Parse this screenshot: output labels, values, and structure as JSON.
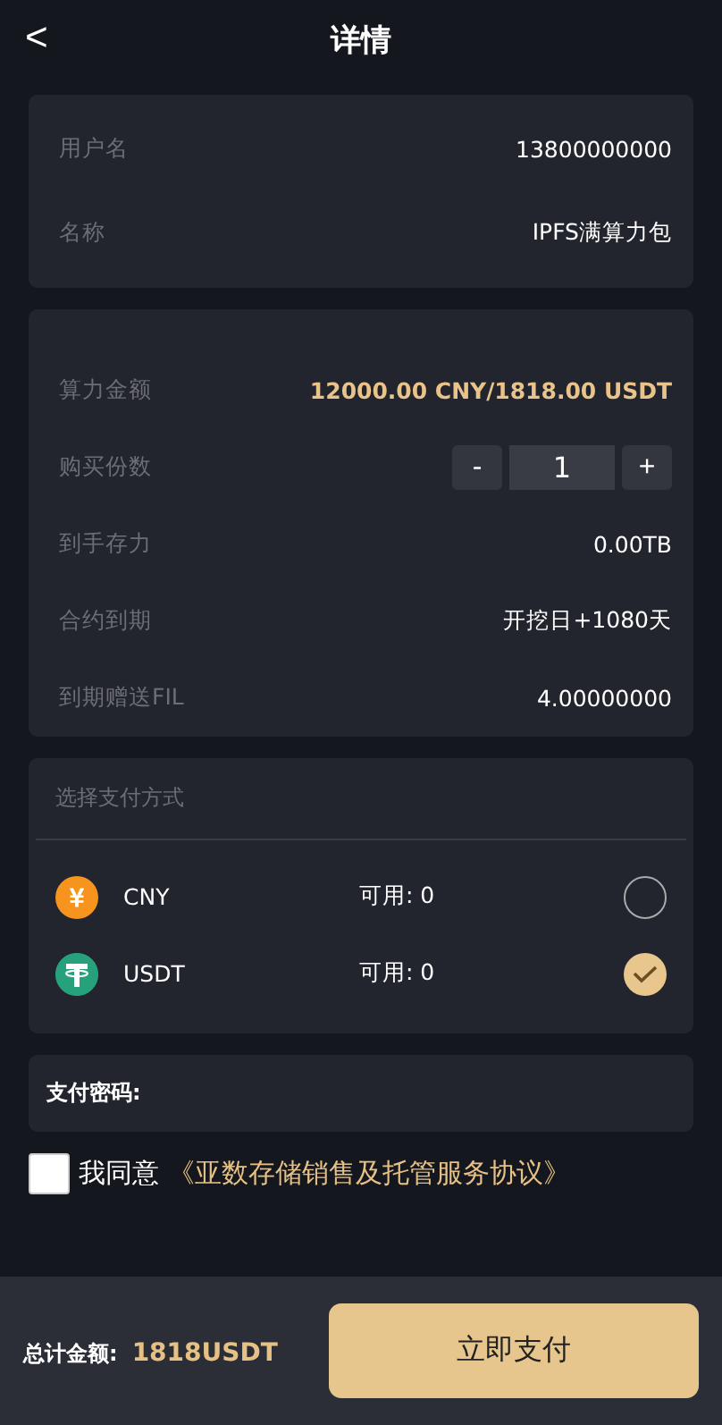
{
  "header": {
    "back": "<",
    "title": "详情"
  },
  "info": [
    {
      "label": "用户名",
      "value": "13800000000"
    },
    {
      "label": "名称",
      "value": "IPFS满算力包"
    }
  ],
  "details": [
    {
      "kind": "text",
      "label": "算力金额",
      "value": "12000.00 CNY/1818.00 USDT",
      "highlight": true
    },
    {
      "kind": "stepper",
      "label": "购买份数",
      "minus": "-",
      "value": "1",
      "plus": "+"
    },
    {
      "kind": "text",
      "label": "到手存力",
      "value": "0.00TB",
      "highlight": false
    },
    {
      "kind": "text",
      "label": "合约到期",
      "value": "开挖日+1080天",
      "highlight": false
    },
    {
      "kind": "text",
      "label": "到期赠送FIL",
      "value": "4.00000000",
      "highlight": false
    }
  ],
  "payment": {
    "title": "选择支付方式",
    "methods": [
      {
        "kind": "yuan",
        "name": "CNY",
        "available": "可用: 0",
        "selected": false
      },
      {
        "kind": "tether",
        "name": "USDT",
        "available": "可用: 0",
        "selected": true
      }
    ]
  },
  "password": {
    "label": "支付密码:"
  },
  "agreement": {
    "checked": false,
    "prefix": "我同意",
    "link": "《亚数存储销售及托管服务协议》"
  },
  "footer": {
    "total_label": "总计金额:",
    "total": "1818USDT",
    "pay": "立即支付"
  }
}
